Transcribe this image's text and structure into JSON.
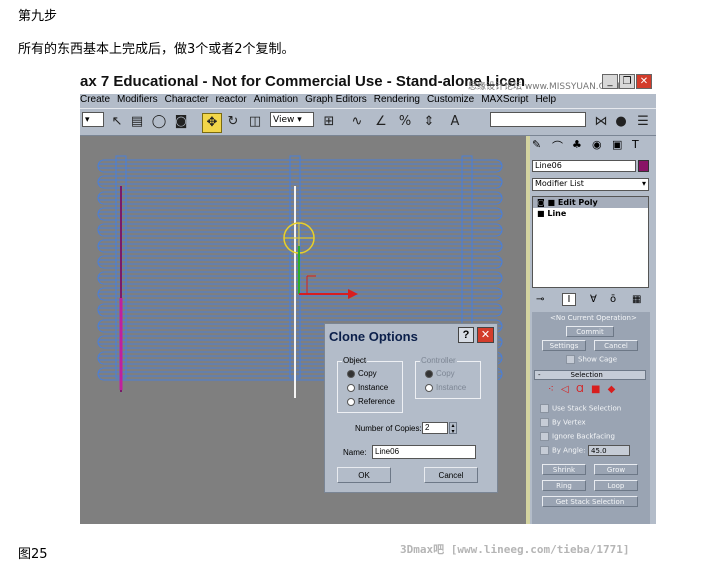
{
  "article": {
    "step_heading": "第九步",
    "instruction": "所有的东西基本上完成后，做3个或者2个复制。",
    "figure_caption": "图25",
    "watermark_bottom": "3Dmax吧 [www.lineeg.com/tieba/1771]"
  },
  "window": {
    "title": "ax 7  Educational - Not for Commercial Use - Stand-alone Licen",
    "watermark_top": "思缘设计论坛  www.MISSYUAN.COM",
    "minimize_label": "_",
    "restore_label": "❐",
    "close_label": "✕"
  },
  "menu": [
    "Create",
    "Modifiers",
    "Character",
    "reactor",
    "Animation",
    "Graph Editors",
    "Rendering",
    "Customize",
    "MAXScript",
    "Help"
  ],
  "toolbar": {
    "view_dropdown": "View",
    "icons": [
      "select-icon",
      "select-by-name-icon",
      "region-icon",
      "crossing-icon",
      "move-icon",
      "rotate-icon",
      "scale-icon",
      "snap-icon",
      "angle-snap-icon",
      "percent-snap-icon",
      "spinner-snap-icon",
      "named-selection-icon",
      "mirror-icon",
      "material-icon",
      "render-icon"
    ]
  },
  "command_panel": {
    "object_name": "Line06",
    "object_color": "#8a1466",
    "modifier_list": "Modifier List",
    "stack": [
      "Edit Poly",
      "Line"
    ],
    "no_current_op": "<No Current Operation>",
    "commit": "Commit",
    "settings": "Settings",
    "cancel": "Cancel",
    "show_cage": "Show Cage",
    "selection_rollout": "Selection",
    "use_stack_selection": "Use Stack Selection",
    "by_vertex": "By Vertex",
    "ignore_backfacing": "Ignore Backfacing",
    "by_angle": "By Angle:",
    "by_angle_value": "45.0",
    "shrink": "Shrink",
    "grow": "Grow",
    "ring": "Ring",
    "loop": "Loop",
    "get_stack_selection": "Get Stack Selection"
  },
  "dialog": {
    "title": "Clone Options",
    "help_label": "?",
    "close_label": "✕",
    "object_group": "Object",
    "object_options": [
      "Copy",
      "Instance",
      "Reference"
    ],
    "object_selected": 0,
    "controller_group": "Controller",
    "controller_options": [
      "Copy",
      "Instance"
    ],
    "controller_selected": 0,
    "copies_label": "Number of Copies:",
    "copies_value": "2",
    "name_label": "Name:",
    "name_value": "Line06",
    "ok_label": "OK",
    "cancel_label": "Cancel"
  },
  "colors": {
    "ui_bg": "#b3bcc9",
    "viewport_bg": "#7f7f7f",
    "wire_blue": "#4a7fd8",
    "gizmo_yellow": "#e8d12a",
    "axis_red": "#d81e1e",
    "axis_green": "#29b02b"
  }
}
